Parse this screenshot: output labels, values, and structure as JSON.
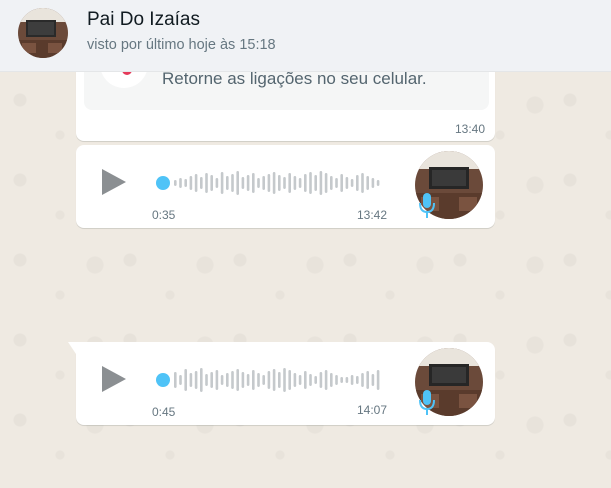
{
  "header": {
    "contact_name": "Pai Do Izaías",
    "status": "visto por último hoje às 15:18",
    "avatar_icon": "contact-avatar-photo"
  },
  "messages": [
    {
      "type": "call-notice",
      "text": "Retorne as ligações no seu celular.",
      "time": "13:40",
      "icon": "missed-call-icon"
    },
    {
      "type": "voice",
      "duration": "0:35",
      "time": "13:42",
      "progress": 0
    },
    {
      "type": "voice",
      "duration": "0:45",
      "time": "14:07",
      "progress": 0
    }
  ],
  "colors": {
    "header_bg": "#f0f2f5",
    "chat_bg": "#efeae2",
    "accent_blue": "#4fc3f7",
    "play_gray": "#8b8f92",
    "missed_red": "#e53a5a"
  }
}
